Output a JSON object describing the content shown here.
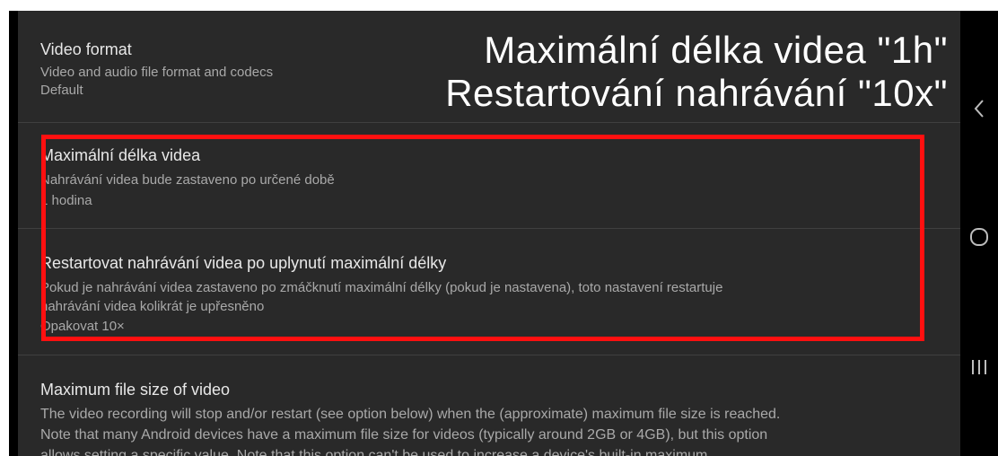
{
  "overlay": {
    "line1": "Maximální délka videa \"1h\"",
    "line2": "Restartování nahrávání \"10x\""
  },
  "settings": [
    {
      "title": "Video format",
      "lines": [
        "Video and audio file format and codecs",
        "Default"
      ]
    },
    {
      "title": "Maximální délka videa",
      "lines": [
        "Nahrávání videa bude zastaveno po určené době",
        "1 hodina"
      ]
    },
    {
      "title": "Restartovat nahrávání videa po uplynutí maximální délky",
      "lines": [
        "Pokud je nahrávání videa zastaveno po zmáčknutí maximální délky (pokud je nastavena), toto nastavení restartuje",
        "nahrávání videa kolikrát je upřesněno",
        "Opakovat 10×"
      ]
    },
    {
      "title": "Maximum file size of video",
      "lines": [
        "The video recording will stop and/or restart (see option below) when the (approximate) maximum file size is reached.",
        "Note that many Android devices have a maximum file size for videos (typically around 2GB or 4GB), but this option",
        "allows setting a specific value. Note that this option can't be used to increase a device's built-in maximum"
      ]
    }
  ],
  "nav": {
    "back": "back-icon",
    "home": "home-icon",
    "recents": "recents-icon"
  },
  "colors": {
    "background": "#292929",
    "title": "#e8e8e8",
    "summary": "#a9a9a9",
    "highlight": "#ff1010"
  }
}
